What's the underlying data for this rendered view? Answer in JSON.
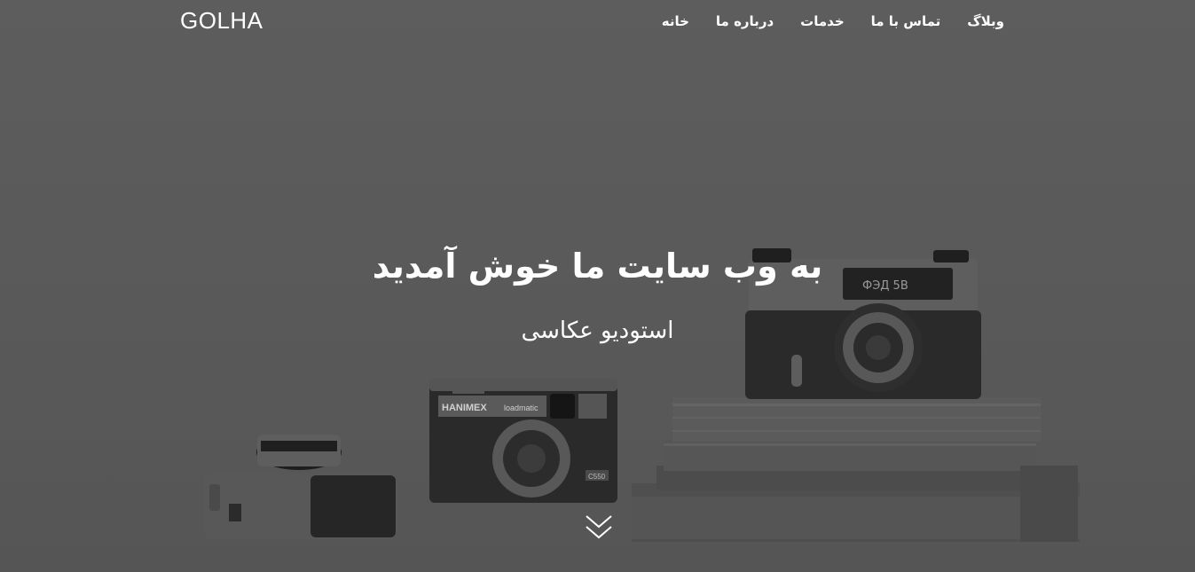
{
  "brand": {
    "name": "GOLHA"
  },
  "nav": {
    "items": [
      {
        "label": "خانه"
      },
      {
        "label": "درباره ما"
      },
      {
        "label": "خدمات"
      },
      {
        "label": "تماس با ما"
      },
      {
        "label": "وبلاگ"
      }
    ]
  },
  "hero": {
    "headline": "به وب سایت ما خوش آمدید",
    "subtitle": "استودیو عکاسی",
    "scroll_icon": "double-chevron-down-icon",
    "camera_labels": {
      "camera_left_brand": "",
      "camera_middle_brand": "HANIMEX",
      "camera_middle_model": "loadmatic",
      "camera_middle_code": "C550",
      "camera_right_model": "ФЭД 5В"
    }
  },
  "colors": {
    "overlay": "#5a5a5a",
    "text": "#ffffff"
  }
}
